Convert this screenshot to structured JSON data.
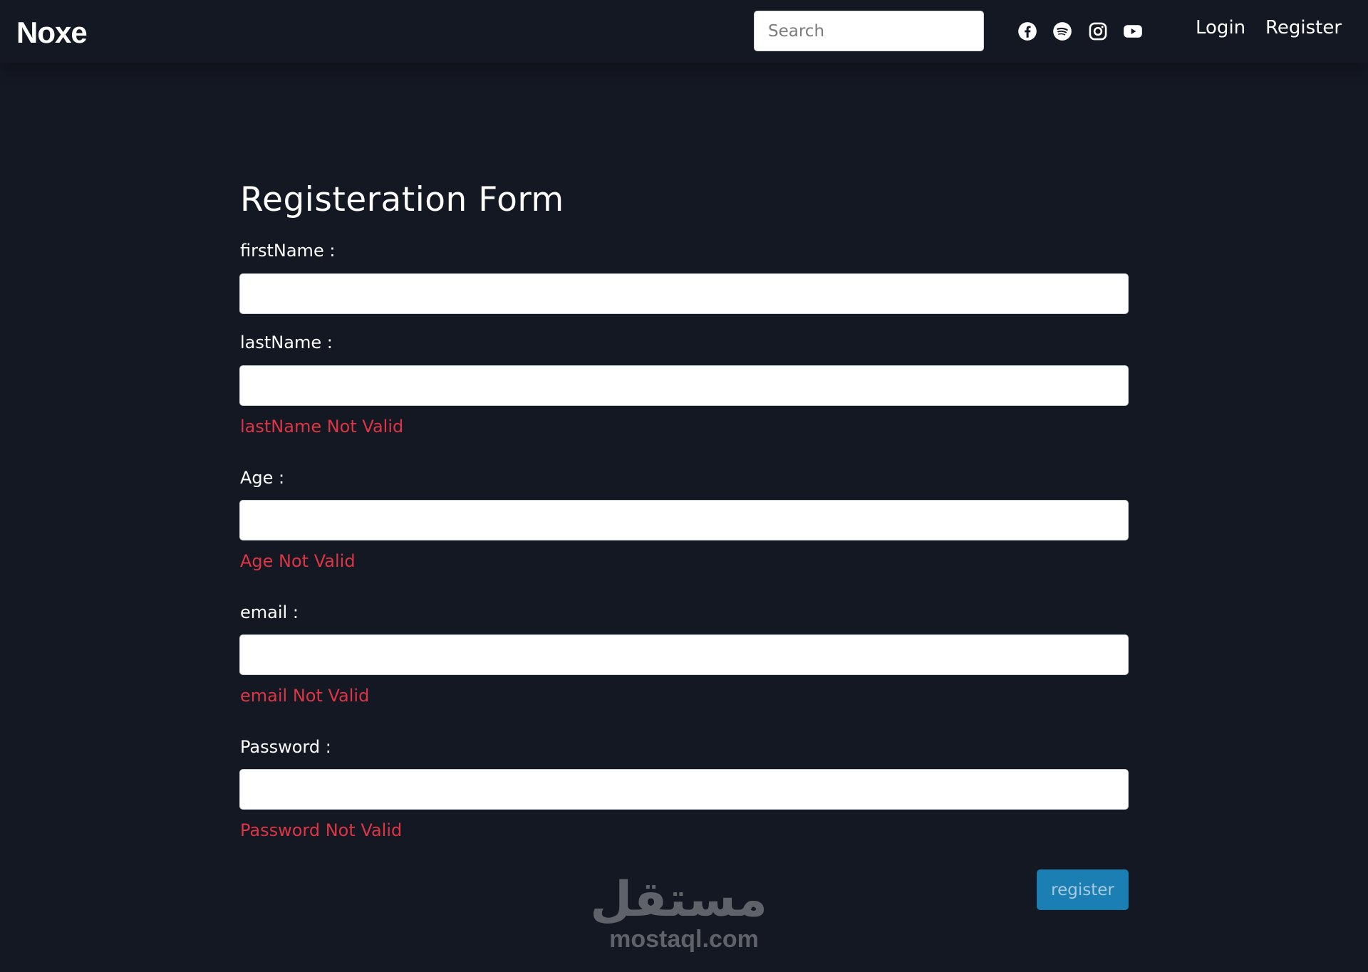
{
  "navbar": {
    "brand": "Noxe",
    "search": {
      "placeholder": "Search",
      "value": ""
    },
    "social": [
      "facebook-icon",
      "spotify-icon",
      "instagram-icon",
      "youtube-icon"
    ],
    "login": "Login",
    "register": "Register"
  },
  "form": {
    "title": "Registeration Form",
    "fields": [
      {
        "label": "firstName :",
        "value": "",
        "error": ""
      },
      {
        "label": "lastName :",
        "value": "",
        "error": "lastName Not Valid"
      },
      {
        "label": "Age :",
        "value": "",
        "error": "Age Not Valid"
      },
      {
        "label": "email :",
        "value": "",
        "error": "email Not Valid"
      },
      {
        "label": "Password :",
        "value": "",
        "error": "Password Not Valid"
      }
    ],
    "submit": "register"
  },
  "watermark": {
    "arabic": "مستقل",
    "latin": "mostaql.com"
  },
  "colors": {
    "background": "#141823",
    "error": "#dc3545",
    "button": "#1c7fb4",
    "watermark": "#5f6369"
  }
}
